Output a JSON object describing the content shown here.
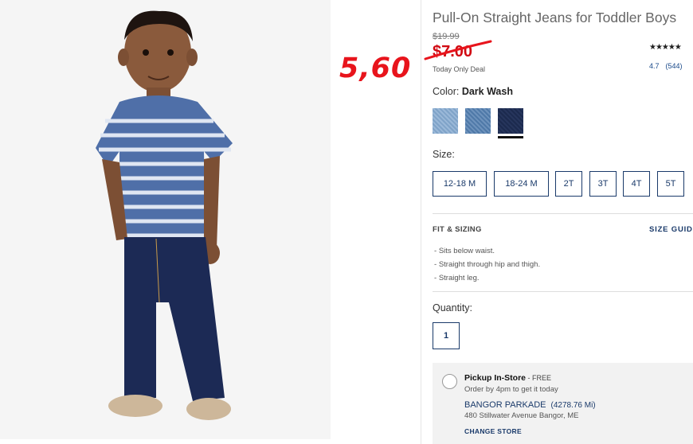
{
  "product": {
    "title": "Pull-On Straight Jeans for Toddler Boys",
    "original_price": "$19.99",
    "sale_price": "$7.00",
    "deal_text": "Today Only Deal",
    "handwritten_price": "5,60",
    "stars": "★★★★★",
    "rating_value": "4.7",
    "review_count": "(544)"
  },
  "color": {
    "label": "Color:",
    "selected": "Dark Wash",
    "swatches": [
      "light-wash",
      "medium-wash",
      "dark-wash"
    ]
  },
  "size": {
    "label": "Size:",
    "options": [
      "12-18 M",
      "18-24 M",
      "2T",
      "3T",
      "4T",
      "5T"
    ]
  },
  "fit": {
    "title": "FIT & SIZING",
    "size_guide": "SIZE GUIDE",
    "items": [
      "Sits below waist.",
      "Straight through hip and thigh.",
      "Straight leg."
    ]
  },
  "quantity": {
    "label": "Quantity:",
    "value": "1"
  },
  "pickup": {
    "title": "Pickup In-Store",
    "free": " - FREE",
    "subtitle": "Order by 4pm to get it today",
    "store_name": "BANGOR PARKADE",
    "distance": "(4278.76 Mi)",
    "address": "480 Stillwater Avenue Bangor, ME",
    "change_store": "CHANGE STORE"
  },
  "colors": {
    "sale_red": "#d10a12",
    "overlay_red": "#e8141c",
    "link_navy": "#1a3a6a"
  }
}
